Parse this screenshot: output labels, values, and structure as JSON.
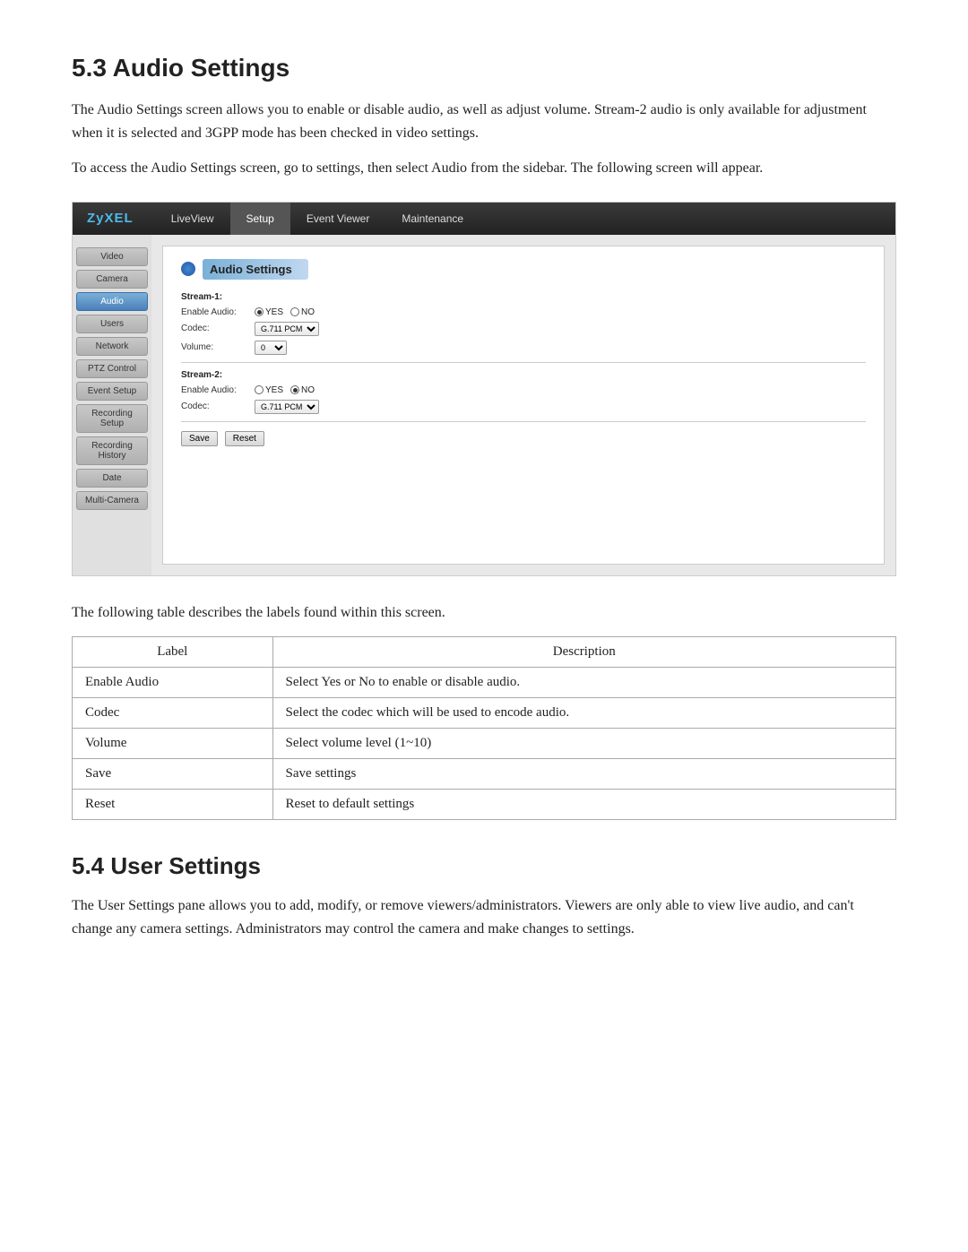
{
  "section1": {
    "heading": "5.3   Audio Settings",
    "para1": "The Audio Settings screen allows you to enable or disable audio, as well as adjust volume. Stream-2 audio is only available for adjustment when it is selected and 3GPP mode has been checked in video settings.",
    "para2": "To access the Audio Settings screen, go to settings, then select Audio from the sidebar. The following screen will appear.",
    "para3": "The following table describes the labels found within this screen."
  },
  "nav": {
    "logo": "ZyXEL",
    "items": [
      "LiveView",
      "Setup",
      "Event Viewer",
      "Maintenance"
    ]
  },
  "sidebar": {
    "items": [
      {
        "label": "Video",
        "active": false
      },
      {
        "label": "Camera",
        "active": false
      },
      {
        "label": "Audio",
        "active": true
      },
      {
        "label": "Users",
        "active": false
      },
      {
        "label": "Network",
        "active": false
      },
      {
        "label": "PTZ Control",
        "active": false
      },
      {
        "label": "Event Setup",
        "active": false
      },
      {
        "label": "Recording Setup",
        "active": false
      },
      {
        "label": "Recording History",
        "active": false
      },
      {
        "label": "Date",
        "active": false
      },
      {
        "label": "Multi-Camera",
        "active": false
      }
    ]
  },
  "panel": {
    "title": "Audio Settings",
    "stream1_label": "Stream-1:",
    "stream1_enable_label": "Enable Audio:",
    "stream1_enable_yes": "YES",
    "stream1_enable_no": "NO",
    "stream1_codec_label": "Codec:",
    "stream1_codec_value": "G.711 PCM",
    "stream1_volume_label": "Volume:",
    "stream1_volume_value": "0",
    "stream2_label": "Stream-2:",
    "stream2_enable_label": "Enable Audio:",
    "stream2_enable_yes": "YES",
    "stream2_enable_no": "NO",
    "stream2_codec_label": "Codec:",
    "stream2_codec_value": "G.711 PCM",
    "save_btn": "Save",
    "reset_btn": "Reset"
  },
  "table": {
    "col1_header": "Label",
    "col2_header": "Description",
    "rows": [
      {
        "label": "Enable Audio",
        "description": "Select Yes or No to enable or disable audio."
      },
      {
        "label": "Codec",
        "description": "Select the codec which will be used to encode audio."
      },
      {
        "label": "Volume",
        "description": "Select volume level (1~10)"
      },
      {
        "label": "Save",
        "description": "Save settings"
      },
      {
        "label": "Reset",
        "description": "Reset to default settings"
      }
    ]
  },
  "section2": {
    "heading": "5.4   User Settings",
    "para1": "The User Settings pane allows you to add, modify, or remove viewers/administrators. Viewers are only able to view live audio, and can't change any camera settings. Administrators may control the camera and make changes to settings."
  }
}
